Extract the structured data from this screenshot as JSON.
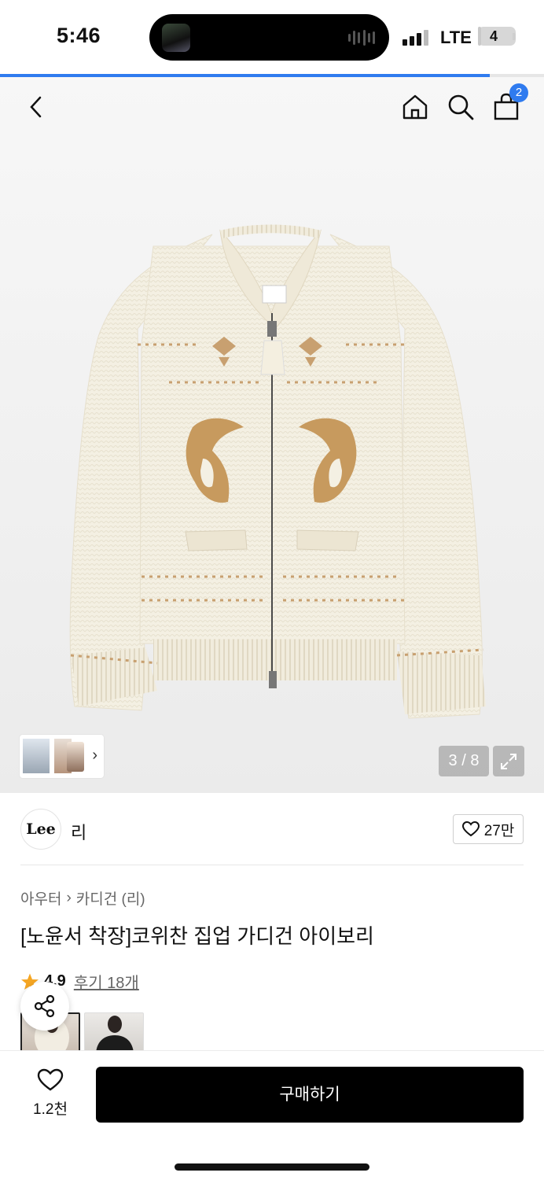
{
  "status_bar": {
    "time": "5:46",
    "network": "LTE",
    "battery": "4",
    "battery_level": 0.04
  },
  "gallery": {
    "progress_fraction": 0.9,
    "page_counter": "3 / 8",
    "cart_count": "2",
    "icons": [
      "back-icon",
      "home-icon",
      "search-icon",
      "shopping-bag-icon",
      "expand-icon"
    ]
  },
  "brand": {
    "logo": "Lee",
    "name": "리",
    "likes": "27만"
  },
  "product": {
    "breadcrumb": [
      "아우터",
      "카디건 (리)"
    ],
    "title": "[노윤서 착장]코위찬 집업 가디건 아이보리",
    "rating": "4.9",
    "review_link": "후기 18개"
  },
  "bottom": {
    "like_count": "1.2천",
    "buy_label": "구매하기"
  },
  "colors": {
    "accent": "#2f7bef",
    "buy_button": "#000000",
    "star": "#f5a623",
    "knit": "#f4f0e3",
    "pattern": "#c8a070"
  }
}
